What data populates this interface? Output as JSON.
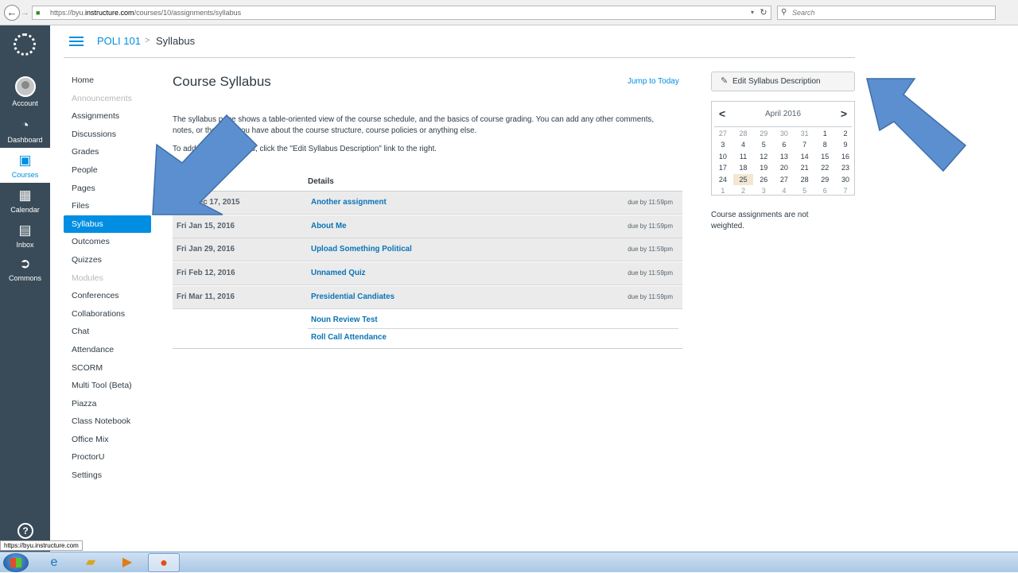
{
  "browser": {
    "url_prefix": "https://byu.",
    "url_host": "instructure.com",
    "url_path": "/courses/10/assignments/syllabus",
    "search_placeholder": "Search"
  },
  "global_nav": {
    "items": [
      {
        "label": "Account",
        "icon": "avatar-icon"
      },
      {
        "label": "Dashboard",
        "icon": "dashboard-gauge-icon"
      },
      {
        "label": "Courses",
        "icon": "courses-book-icon"
      },
      {
        "label": "Calendar",
        "icon": "calendar-icon"
      },
      {
        "label": "Inbox",
        "icon": "inbox-icon"
      },
      {
        "label": "Commons",
        "icon": "commons-icon"
      }
    ],
    "help_label": "?"
  },
  "breadcrumb": {
    "course": "POLI 101",
    "separator": ">",
    "page": "Syllabus"
  },
  "course_nav": [
    {
      "label": "Home"
    },
    {
      "label": "Announcements",
      "disabled": true
    },
    {
      "label": "Assignments"
    },
    {
      "label": "Discussions"
    },
    {
      "label": "Grades"
    },
    {
      "label": "People"
    },
    {
      "label": "Pages"
    },
    {
      "label": "Files"
    },
    {
      "label": "Syllabus",
      "active": true
    },
    {
      "label": "Outcomes"
    },
    {
      "label": "Quizzes"
    },
    {
      "label": "Modules",
      "disabled": true
    },
    {
      "label": "Conferences"
    },
    {
      "label": "Collaborations"
    },
    {
      "label": "Chat"
    },
    {
      "label": "Attendance"
    },
    {
      "label": "SCORM"
    },
    {
      "label": "Multi Tool (Beta)"
    },
    {
      "label": "Piazza"
    },
    {
      "label": "Class Notebook"
    },
    {
      "label": "Office Mix"
    },
    {
      "label": "ProctorU"
    },
    {
      "label": "Settings"
    }
  ],
  "main": {
    "title": "Course Syllabus",
    "jump_today": "Jump to Today",
    "desc1": "The syllabus page shows a table-oriented view of the course schedule, and the basics of course grading. You can add any other comments, notes, or thoughts you have about the course structure, course policies or anything else.",
    "desc2": "To add some comments, click the \"Edit Syllabus Description\" link to the right.",
    "details_header": "Details",
    "schedule": [
      {
        "date": "Thu Dec 17, 2015",
        "title": "Another assignment",
        "due": "due by 11:59pm"
      },
      {
        "date": "Fri Jan 15, 2016",
        "title": "About Me",
        "due": "due by 11:59pm"
      },
      {
        "date": "Fri Jan 29, 2016",
        "title": "Upload Something Political",
        "due": "due by 11:59pm"
      },
      {
        "date": "Fri Feb 12, 2016",
        "title": "Unnamed Quiz",
        "due": "due by 11:59pm"
      },
      {
        "date": "Fri Mar 11, 2016",
        "title": "Presidential Candiates",
        "due": "due by 11:59pm"
      }
    ],
    "undated": [
      {
        "title": "Noun Review Test"
      },
      {
        "title": "Roll Call Attendance"
      }
    ]
  },
  "sidebar": {
    "edit_button": "Edit Syllabus Description",
    "calendar": {
      "month": "April 2016",
      "prev": "<",
      "next": ">",
      "days": [
        {
          "d": "27",
          "other": true
        },
        {
          "d": "28",
          "other": true
        },
        {
          "d": "29",
          "other": true
        },
        {
          "d": "30",
          "other": true
        },
        {
          "d": "31",
          "other": true
        },
        {
          "d": "1"
        },
        {
          "d": "2"
        },
        {
          "d": "3"
        },
        {
          "d": "4"
        },
        {
          "d": "5"
        },
        {
          "d": "6"
        },
        {
          "d": "7"
        },
        {
          "d": "8"
        },
        {
          "d": "9"
        },
        {
          "d": "10"
        },
        {
          "d": "11"
        },
        {
          "d": "12"
        },
        {
          "d": "13"
        },
        {
          "d": "14"
        },
        {
          "d": "15"
        },
        {
          "d": "16"
        },
        {
          "d": "17"
        },
        {
          "d": "18"
        },
        {
          "d": "19"
        },
        {
          "d": "20"
        },
        {
          "d": "21"
        },
        {
          "d": "22"
        },
        {
          "d": "23"
        },
        {
          "d": "24"
        },
        {
          "d": "25",
          "today": true
        },
        {
          "d": "26"
        },
        {
          "d": "27"
        },
        {
          "d": "28"
        },
        {
          "d": "29"
        },
        {
          "d": "30"
        },
        {
          "d": "1",
          "other": true
        },
        {
          "d": "2",
          "other": true
        },
        {
          "d": "3",
          "other": true
        },
        {
          "d": "4",
          "other": true
        },
        {
          "d": "5",
          "other": true
        },
        {
          "d": "6",
          "other": true
        },
        {
          "d": "7",
          "other": true
        }
      ]
    },
    "weight_note": "Course assignments are not weighted."
  },
  "status_url": "https://byu.instructure.com",
  "colors": {
    "accent": "#008ee2",
    "nav_bg": "#394b58",
    "arrow": "#5b8fd0"
  },
  "taskbar": [
    "start-icon",
    "ie-icon",
    "explorer-icon",
    "media-player-icon",
    "firefox-icon"
  ]
}
